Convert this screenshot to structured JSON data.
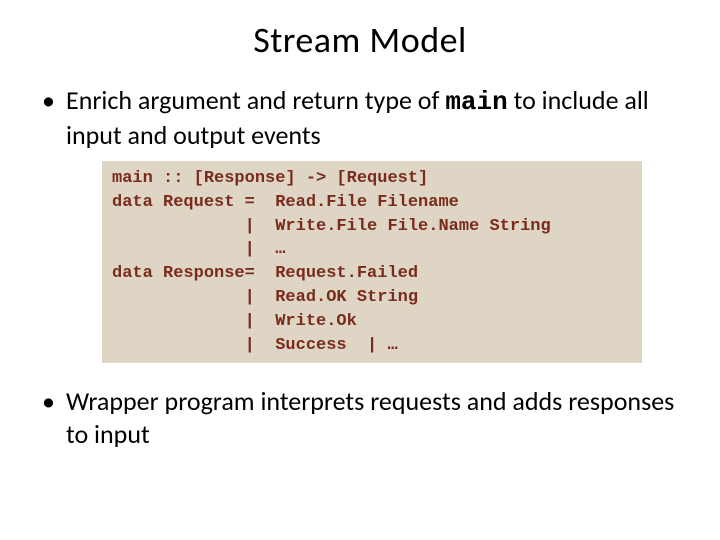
{
  "title": "Stream Model",
  "bullet1_pre": "Enrich argument and return type of ",
  "bullet1_code": "main",
  "bullet1_post": " to include all input and output events",
  "code": "main :: [Response] -> [Request]\ndata Request =  Read.File Filename\n             |  Write.File File.Name String\n             |  …\ndata Response=  Request.Failed\n             |  Read.OK String\n             |  Write.Ok\n             |  Success  | …",
  "bullet2": "Wrapper program interprets requests and adds responses to input"
}
